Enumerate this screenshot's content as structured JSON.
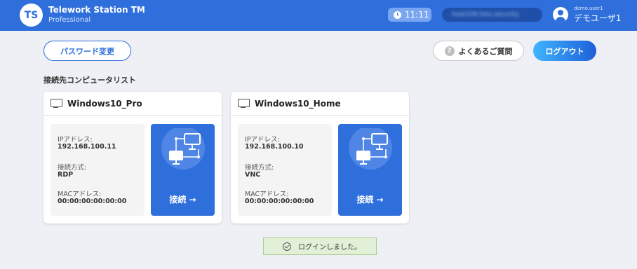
{
  "header": {
    "logo": "TS",
    "title": "Telework Station TM",
    "edition": "Professional",
    "time": "11:11",
    "server": "host109.fotx.security",
    "user_id": "demo.user1",
    "user_name": "デモユーザ1"
  },
  "toolbar": {
    "password_button": "パスワード変更",
    "faq_button": "よくあるご質問",
    "faq_icon_glyph": "?",
    "logout_button": "ログアウト"
  },
  "list_heading": "接続先コンピュータリスト",
  "computers": [
    {
      "name": "Windows10_Pro",
      "ip_label": "IPアドレス:",
      "ip": "192.168.100.11",
      "method_label": "接続方式:",
      "method": "RDP",
      "mac_label": "MACアドレス:",
      "mac": "00:00:00:00:00:00",
      "connect_label": "接続 →"
    },
    {
      "name": "Windows10_Home",
      "ip_label": "IPアドレス:",
      "ip": "192.168.100.10",
      "method_label": "接続方式:",
      "method": "VNC",
      "mac_label": "MACアドレス:",
      "mac": "00:00:00:00:00:00",
      "connect_label": "接続 →"
    }
  ],
  "toast": {
    "message": "ログインしました。"
  },
  "colors": {
    "brand": "#2f6fdc",
    "background": "#eef0f6",
    "success_bg": "#e3f0d8"
  }
}
